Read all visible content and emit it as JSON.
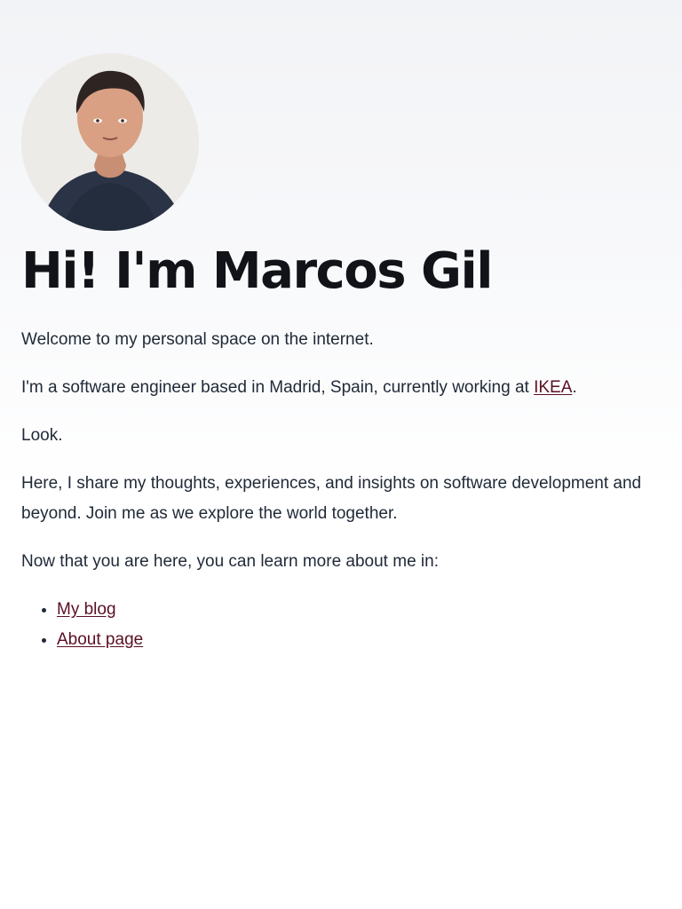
{
  "profile": {
    "avatar_alt": "Marcos Gil",
    "heading": "Hi! I'm Marcos Gil"
  },
  "content": {
    "intro": "Welcome to my personal space on the internet.",
    "work_prefix": "I'm a software engineer based in Madrid, Spain, currently working at ",
    "work_link": "IKEA",
    "work_suffix": ".",
    "look": "Look.",
    "share": "Here, I share my thoughts, experiences, and insights on software development and beyond. Join me as we explore the world together.",
    "learn_more": "Now that you are here, you can learn more about me in:",
    "links": [
      {
        "label": "My blog"
      },
      {
        "label": "About page"
      }
    ]
  },
  "colors": {
    "link": "#5a0f22",
    "heading": "#111318",
    "text": "#1f2937"
  },
  "icons": {
    "avatar": "profile-photo"
  }
}
